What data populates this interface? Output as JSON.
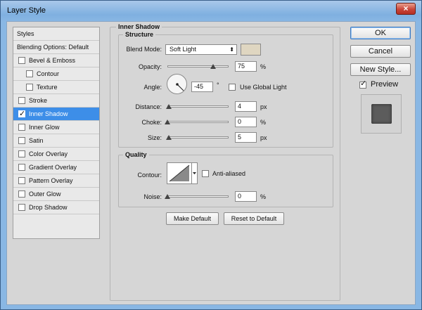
{
  "window": {
    "title": "Layer Style",
    "close_glyph": "×"
  },
  "sidebar": {
    "styles_header": "Styles",
    "blending_options": "Blending Options: Default",
    "items": [
      {
        "label": "Bevel & Emboss",
        "checked": false,
        "indent": 0,
        "active": false
      },
      {
        "label": "Contour",
        "checked": false,
        "indent": 1,
        "active": false
      },
      {
        "label": "Texture",
        "checked": false,
        "indent": 1,
        "active": false
      },
      {
        "label": "Stroke",
        "checked": false,
        "indent": 0,
        "active": false
      },
      {
        "label": "Inner Shadow",
        "checked": true,
        "indent": 0,
        "active": true
      },
      {
        "label": "Inner Glow",
        "checked": false,
        "indent": 0,
        "active": false
      },
      {
        "label": "Satin",
        "checked": false,
        "indent": 0,
        "active": false
      },
      {
        "label": "Color Overlay",
        "checked": false,
        "indent": 0,
        "active": false
      },
      {
        "label": "Gradient Overlay",
        "checked": false,
        "indent": 0,
        "active": false
      },
      {
        "label": "Pattern Overlay",
        "checked": false,
        "indent": 0,
        "active": false
      },
      {
        "label": "Outer Glow",
        "checked": false,
        "indent": 0,
        "active": false
      },
      {
        "label": "Drop Shadow",
        "checked": false,
        "indent": 0,
        "active": false
      }
    ]
  },
  "inner_shadow": {
    "section_title": "Inner Shadow",
    "structure": {
      "title": "Structure",
      "blend_mode_label": "Blend Mode:",
      "blend_mode_value": "Soft Light",
      "dropdown_arrow": "⬍",
      "shadow_color": "#dfd6c1",
      "opacity_label": "Opacity:",
      "opacity_value": "75",
      "opacity_unit": "%",
      "opacity_fraction": 0.75,
      "angle_label": "Angle:",
      "angle_value": "-45",
      "angle_unit": "°",
      "use_global_light_label": "Use Global Light",
      "use_global_light_checked": false,
      "distance_label": "Distance:",
      "distance_value": "4",
      "distance_unit": "px",
      "distance_fraction": 0.02,
      "choke_label": "Choke:",
      "choke_value": "0",
      "choke_unit": "%",
      "choke_fraction": 0.0,
      "size_label": "Size:",
      "size_value": "5",
      "size_unit": "px",
      "size_fraction": 0.02
    },
    "quality": {
      "title": "Quality",
      "contour_label": "Contour:",
      "anti_aliased_label": "Anti-aliased",
      "anti_aliased_checked": false,
      "noise_label": "Noise:",
      "noise_value": "0",
      "noise_unit": "%",
      "noise_fraction": 0.0
    },
    "make_default_label": "Make Default",
    "reset_default_label": "Reset to Default"
  },
  "actions": {
    "ok_label": "OK",
    "cancel_label": "Cancel",
    "new_style_label": "New Style...",
    "preview_label": "Preview",
    "preview_checked": true
  },
  "colors": {
    "selection": "#3d8ee8",
    "preview_swatch": "#5c5c5c"
  }
}
